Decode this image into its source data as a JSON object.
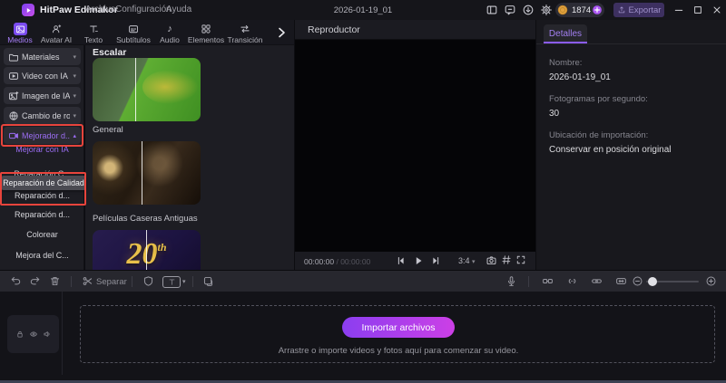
{
  "colors": {
    "accent_purple": "#8b5cf6",
    "highlight_red": "#e8443c",
    "import_gradient_start": "#8b3ef0",
    "import_gradient_end": "#cc3fe6",
    "coin_gold": "#e3a23f"
  },
  "icons": {
    "caret_down": "▾",
    "caret_up": "▴",
    "music_note": "♪"
  },
  "titlebar": {
    "app_name": "HitPaw Edimakor",
    "menu_items": [
      {
        "label": "Archivo"
      },
      {
        "label": "Configuración"
      },
      {
        "label": "Ayuda"
      }
    ],
    "project_title": "2026-01-19_01",
    "credits_count": "1874",
    "export_label": "Exportar"
  },
  "media_tabs": {
    "items": [
      {
        "label": "Medios"
      },
      {
        "label": "Avatar AI"
      },
      {
        "label": "Texto"
      },
      {
        "label": "Subtítulos"
      },
      {
        "label": "Audio"
      },
      {
        "label": "Elementos"
      },
      {
        "label": "Transición"
      }
    ]
  },
  "sidebar": {
    "categories": [
      {
        "label": "Materiales"
      },
      {
        "label": "Video con IA"
      },
      {
        "label": "Imagen de IA"
      },
      {
        "label": "Cambio de ro..."
      },
      {
        "label": "Mejorador d..."
      }
    ],
    "subitems": [
      {
        "label": "Mejorar con IA"
      },
      {
        "label": "Reparación C..."
      },
      {
        "label": "Reparación d..."
      },
      {
        "label": "Reparación d..."
      },
      {
        "label": "Colorear"
      },
      {
        "label": "Mejora del C..."
      }
    ],
    "tooltip_text": "Reparación de Calidad"
  },
  "library": {
    "section_title": "Escalar",
    "items": [
      {
        "caption": "General"
      },
      {
        "caption": "Películas Caseras Antiguas"
      },
      {
        "caption": "",
        "thumb_label_main": "20",
        "thumb_label_sup": "th"
      }
    ]
  },
  "player": {
    "panel_title": "Reproductor",
    "current_time": "00:00:00",
    "time_separator": " / ",
    "total_time": "00:00:00",
    "aspect_ratio": "3:4"
  },
  "details": {
    "tab_label": "Detalles",
    "fields": [
      {
        "label": "Nombre:",
        "value": "2026-01-19_01"
      },
      {
        "label": "Fotogramas por segundo:",
        "value": "30"
      },
      {
        "label": "Ubicación de importación:",
        "value": "Conservar en posición original"
      }
    ]
  },
  "timeline_toolbar": {
    "split_label": "Separar"
  },
  "import_zone": {
    "button_label": "Importar archivos",
    "hint_text": "Arrastre o importe videos y fotos aquí para comenzar su video."
  }
}
